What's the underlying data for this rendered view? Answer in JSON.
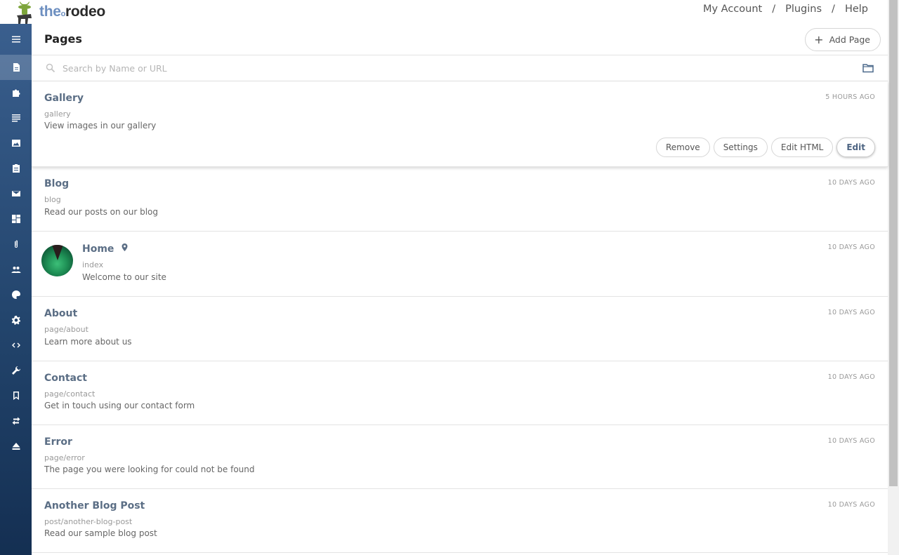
{
  "brand": {
    "the": "the",
    "rodeo": "rodeo"
  },
  "topnav": {
    "account": "My Account",
    "plugins": "Plugins",
    "help": "Help",
    "sep": "/"
  },
  "sidebar": {
    "items": [
      {
        "icon": "menu-icon"
      },
      {
        "icon": "page-icon",
        "active": true
      },
      {
        "icon": "puzzle-icon"
      },
      {
        "icon": "list-icon"
      },
      {
        "icon": "image-icon"
      },
      {
        "icon": "clipboard-icon"
      },
      {
        "icon": "mail-icon"
      },
      {
        "icon": "dashboard-icon"
      },
      {
        "icon": "paperclip-icon"
      },
      {
        "icon": "users-icon"
      },
      {
        "icon": "palette-icon"
      },
      {
        "icon": "gear-icon"
      },
      {
        "icon": "code-icon"
      },
      {
        "icon": "wrench-icon"
      },
      {
        "icon": "bookmark-icon"
      },
      {
        "icon": "swap-icon"
      },
      {
        "icon": "eject-icon"
      }
    ]
  },
  "header": {
    "title": "Pages",
    "add_label": "Add Page"
  },
  "search": {
    "placeholder": "Search by Name or URL"
  },
  "pages": [
    {
      "name": "Gallery",
      "url": "gallery",
      "desc": "View images in our gallery",
      "time": "5 HOURS AGO"
    },
    {
      "name": "Blog",
      "url": "blog",
      "desc": "Read our posts on our blog",
      "time": "10 DAYS AGO"
    },
    {
      "name": "Home",
      "url": "index",
      "desc": "Welcome to our site",
      "time": "10 DAYS AGO"
    },
    {
      "name": "About",
      "url": "page/about",
      "desc": "Learn more about us",
      "time": "10 DAYS AGO"
    },
    {
      "name": "Contact",
      "url": "page/contact",
      "desc": "Get in touch using our contact form",
      "time": "10 DAYS AGO"
    },
    {
      "name": "Error",
      "url": "page/error",
      "desc": "The page you were looking for could not be found",
      "time": "10 DAYS AGO"
    },
    {
      "name": "Another Blog Post",
      "url": "post/another-blog-post",
      "desc": "Read our sample blog post",
      "time": "10 DAYS AGO"
    }
  ],
  "actions": {
    "remove": "Remove",
    "settings": "Settings",
    "edit_html": "Edit HTML",
    "edit": "Edit"
  }
}
